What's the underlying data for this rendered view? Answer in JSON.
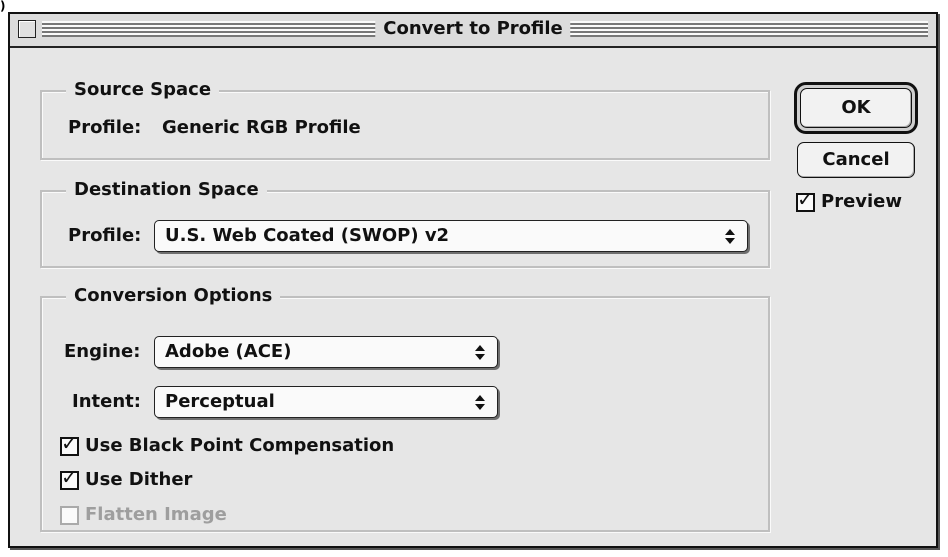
{
  "window": {
    "title": "Convert to Profile"
  },
  "source_space": {
    "legend": "Source Space",
    "profile_label": "Profile:",
    "profile_value": "Generic RGB Profile"
  },
  "destination_space": {
    "legend": "Destination Space",
    "profile_label": "Profile:",
    "profile_value": "U.S. Web Coated (SWOP) v2"
  },
  "conversion_options": {
    "legend": "Conversion Options",
    "engine_label": "Engine:",
    "engine_value": "Adobe (ACE)",
    "intent_label": "Intent:",
    "intent_value": "Perceptual",
    "black_point": {
      "label": "Use Black Point Compensation",
      "checked": true
    },
    "dither": {
      "label": "Use Dither",
      "checked": true
    },
    "flatten": {
      "label": "Flatten Image",
      "checked": false,
      "enabled": false
    }
  },
  "buttons": {
    "ok": "OK",
    "cancel": "Cancel"
  },
  "preview": {
    "label": "Preview",
    "checked": true
  },
  "icons": {
    "checkmark": "✓",
    "close": "close-box-icon",
    "popup_arrows": "up-down-arrows-icon"
  }
}
